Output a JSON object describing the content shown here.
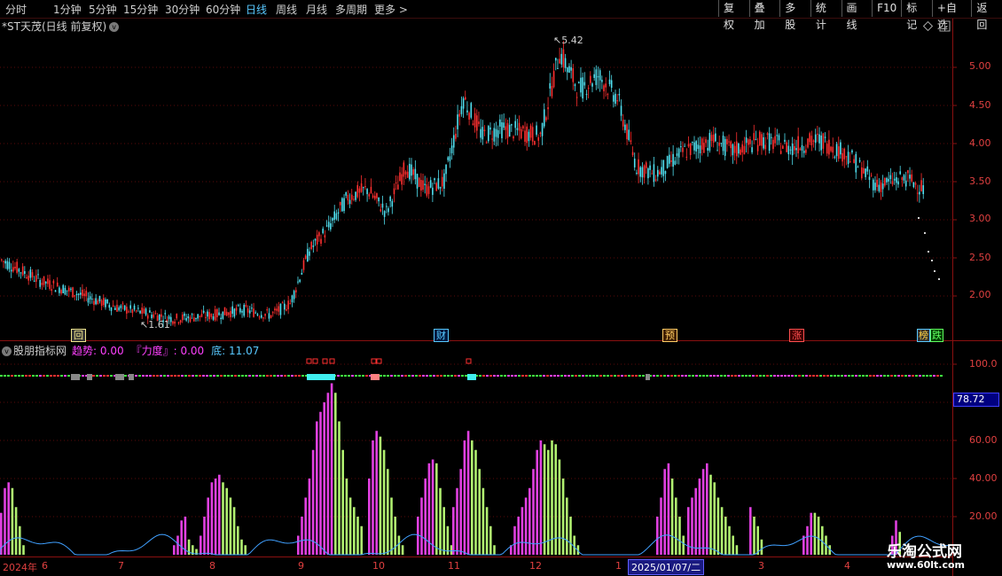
{
  "toolbar": {
    "periods": [
      "分时",
      "1分钟",
      "5分钟",
      "15分钟",
      "30分钟",
      "60分钟",
      "日线",
      "周线",
      "月线",
      "多周期",
      "更多"
    ],
    "active_index": 6,
    "more_arrow": ">",
    "right_buttons": [
      "复权",
      "叠加",
      "多股",
      "统计",
      "画线",
      "F10",
      "标记",
      "+自选",
      "返回"
    ]
  },
  "chart": {
    "title": "*ST天茂(日线 前复权)",
    "high_label": "5.42",
    "low_label": "1.61",
    "price_axis": [
      "5.00",
      "4.50",
      "4.00",
      "3.50",
      "3.00",
      "2.50",
      "2.00"
    ],
    "events": [
      {
        "label": "回",
        "color": "#f0e68c",
        "bg": "#333"
      },
      {
        "label": "财",
        "color": "#58c8ff",
        "bg": "#001a40"
      },
      {
        "label": "预",
        "color": "#ffcc66",
        "bg": "#402000"
      },
      {
        "label": "涨",
        "color": "#ff5050",
        "bg": "#400000"
      },
      {
        "label": "榜",
        "color": "#ffd040",
        "bg": "#303030"
      },
      {
        "label": "跌",
        "color": "#60ff60",
        "bg": "#004000"
      }
    ]
  },
  "indicator": {
    "name": "股朋指标网",
    "trend": "趋势: 0.00",
    "force": "『力度』: 0.00",
    "bottom": "底: 11.07",
    "axis": [
      "100.0",
      "60.00",
      "40.00",
      "20.00"
    ],
    "current_value": "78.72"
  },
  "dates": {
    "ticks": [
      "2024年",
      "6",
      "7",
      "8",
      "9",
      "10",
      "11",
      "12",
      "1",
      "3",
      "4"
    ],
    "selected": "2025/01/07/二"
  },
  "watermark": {
    "title": "乐淘公式网",
    "url": "www.60lt.com"
  },
  "colors": {
    "up": "#ff3030",
    "down": "#50e0f0",
    "bar_a": "#e040e0",
    "bar_b": "#b0f070",
    "line": "#40a0ff"
  }
}
